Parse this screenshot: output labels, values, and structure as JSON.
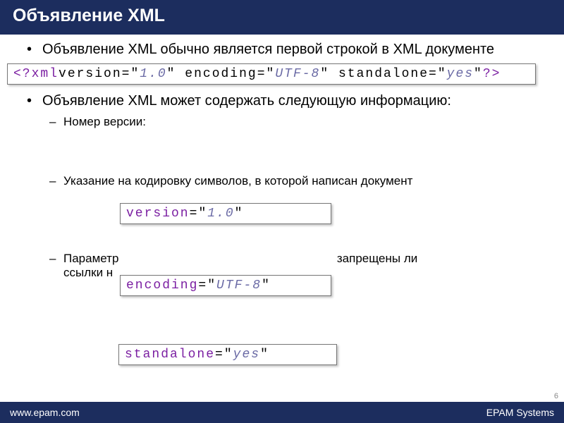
{
  "header": {
    "title": "Объявление XML"
  },
  "bullets": {
    "first": "Объявление XML обычно является первой строкой в XML документе",
    "second": "Объявление XML может содержать следующую информацию:",
    "sub": {
      "version_label": "Номер версии:",
      "encoding_label": "Указание на кодировку символов, в которой написан документ",
      "standalone_prefix": "Параметр",
      "standalone_middle": "запрещены ли",
      "standalone_after": "ссылки н"
    }
  },
  "code": {
    "full": {
      "open": "<?xml",
      "attr1": "version",
      "val1": "1.0",
      "attr2": "encoding",
      "val2": "UTF-8",
      "attr3": "standalone",
      "val3": "yes",
      "close": "?>"
    },
    "box_version": {
      "attr": "version",
      "val": "1.0"
    },
    "box_encoding": {
      "attr": "encoding",
      "val": "UTF-8"
    },
    "box_standalone": {
      "attr": "standalone",
      "val": "yes"
    }
  },
  "footer": {
    "left": "www.epam.com",
    "right": "EPAM Systems"
  },
  "page_number": "6"
}
